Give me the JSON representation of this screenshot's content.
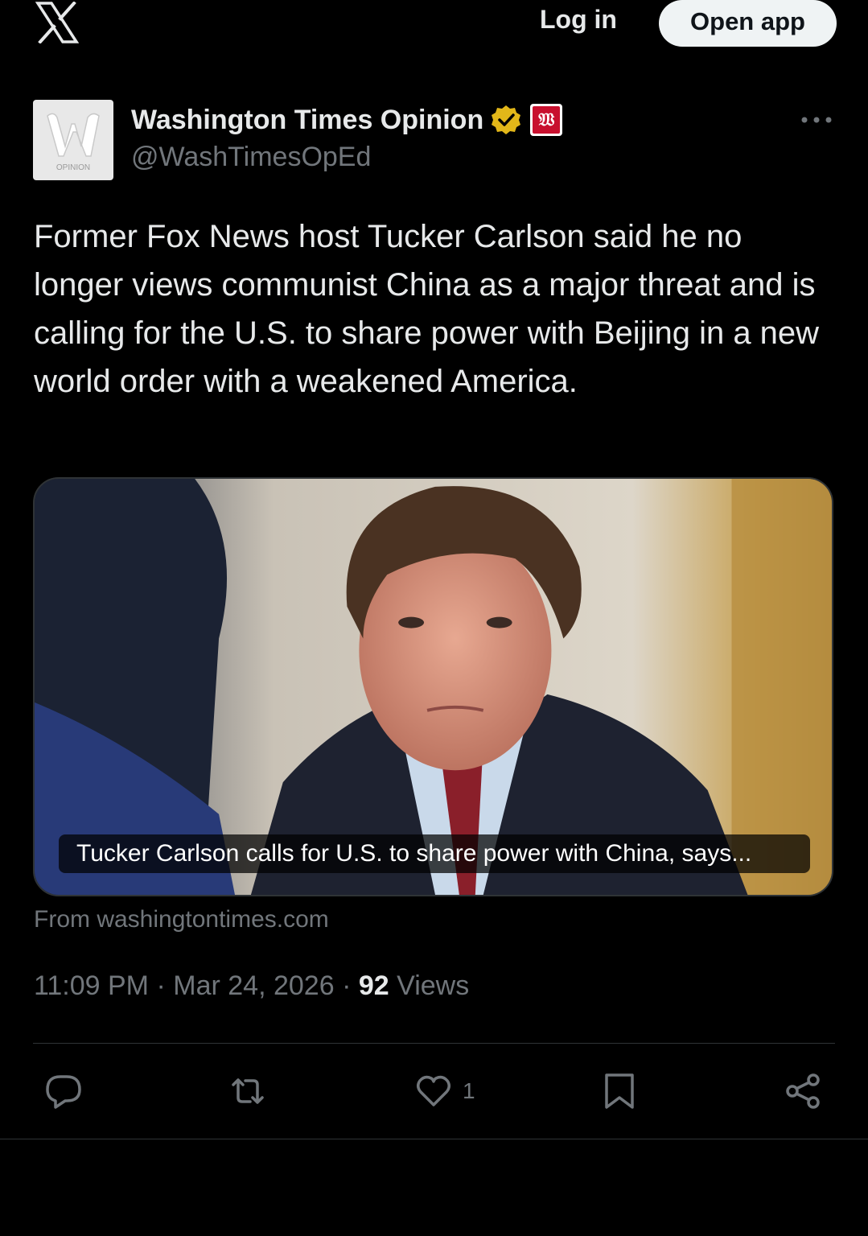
{
  "header": {
    "logo_icon": "x-logo-icon",
    "login_label": "Log in",
    "open_app_label": "Open app"
  },
  "author": {
    "avatar_text": "OPINION",
    "display_name": "Washington Times Opinion",
    "verified_icon": "verified-badge-icon",
    "affiliate_badge_text": "𝔚",
    "handle": "@WashTimesOpEd"
  },
  "tweet": {
    "text": "Former Fox News host Tucker Carlson said he no longer views communist China as a major threat and is calling for the U.S. to share power with Beijing in a new world order with a weakened America.",
    "card": {
      "caption": "Tucker Carlson calls for U.S. to share power with China, says...",
      "source": "From washingtontimes.com"
    },
    "time": "11:09 PM",
    "separator": "·",
    "date": "Mar 24, 2026",
    "views_count": "92",
    "views_label": "Views"
  },
  "actions": {
    "reply_icon": "reply-icon",
    "repost_icon": "repost-icon",
    "like_icon": "heart-icon",
    "like_count": "1",
    "bookmark_icon": "bookmark-icon",
    "share_icon": "share-icon"
  },
  "colors": {
    "background": "#000000",
    "text_primary": "#e7e9ea",
    "text_secondary": "#71767b",
    "divider": "#2f3336",
    "verified_gold": "#e2b719",
    "affiliate_red": "#c8102e"
  }
}
